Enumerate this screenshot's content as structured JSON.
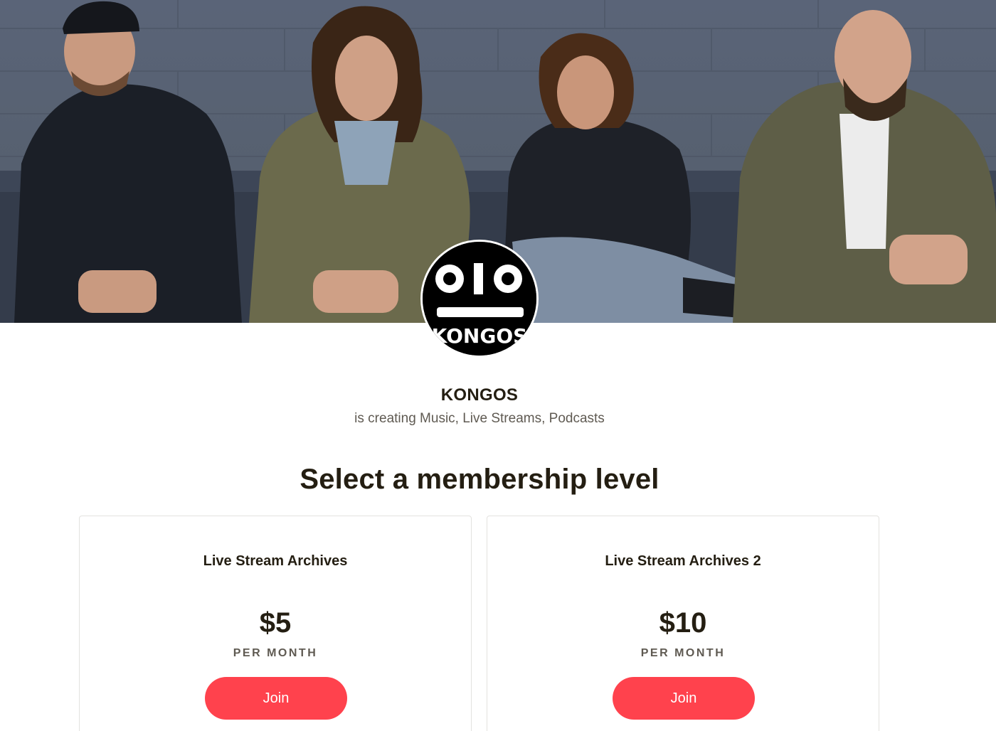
{
  "creator": {
    "name": "KONGOS",
    "tagline": "is creating Music, Live Streams, Podcasts",
    "logo_text": "KONGOS"
  },
  "membership": {
    "title": "Select a membership level",
    "tiers": [
      {
        "name": "Live Stream Archives",
        "price": "$5",
        "period": "PER MONTH",
        "button_label": "Join"
      },
      {
        "name": "Live Stream Archives 2",
        "price": "$10",
        "period": "PER MONTH",
        "button_label": "Join"
      }
    ]
  },
  "colors": {
    "accent": "#ff424d",
    "text": "#241e12",
    "muted": "#5f5a52"
  }
}
